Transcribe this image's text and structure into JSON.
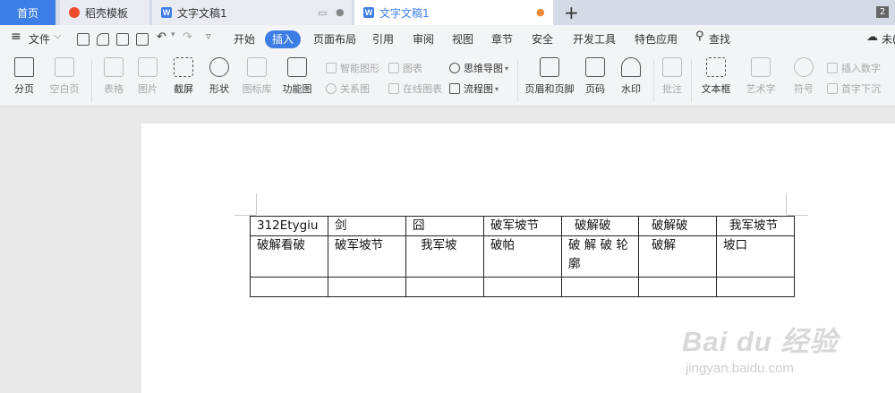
{
  "tabs": {
    "home": "首页",
    "t1": "稻壳模板",
    "t2": "文字文稿1",
    "t3": "文字文稿1",
    "count": "2"
  },
  "menu": {
    "file": "文件",
    "items": [
      "开始",
      "插入",
      "页面布局",
      "引用",
      "审阅",
      "视图",
      "章节",
      "安全",
      "开发工具",
      "特色应用"
    ],
    "search": "查找",
    "right": "未("
  },
  "ribbon": {
    "page_break": "分页",
    "blank_page": "空白页",
    "table": "表格",
    "picture": "图片",
    "screenshot": "截屏",
    "shape": "形状",
    "icon_lib": "图标库",
    "func_chart": "功能图",
    "smart_shape": "智能图形",
    "chart": "图表",
    "mindmap": "思维导图",
    "relation": "关系图",
    "online_chart": "在线图表",
    "flowchart": "流程图",
    "header_footer": "页眉和页脚",
    "page_num": "页码",
    "watermark": "水印",
    "comment": "批注",
    "textbox": "文本框",
    "wordart": "艺术字",
    "symbol": "符号",
    "insert_num": "插入数字",
    "dropcap": "首字下沉"
  },
  "table": {
    "rows": [
      [
        "312Etygiu",
        "剑",
        "囧",
        "破军坡节",
        "破解破",
        "破解破",
        "我军坡节"
      ],
      [
        "破解看破",
        "破军坡节",
        "我军坡",
        "破帕",
        "破 解 破 轮 廓",
        "破解",
        "坡口"
      ],
      [
        "",
        "",
        "",
        "",
        "",
        "",
        ""
      ]
    ]
  },
  "watermark": {
    "brand": "Bai du 经验",
    "url": "jingyan.baidu.com"
  }
}
